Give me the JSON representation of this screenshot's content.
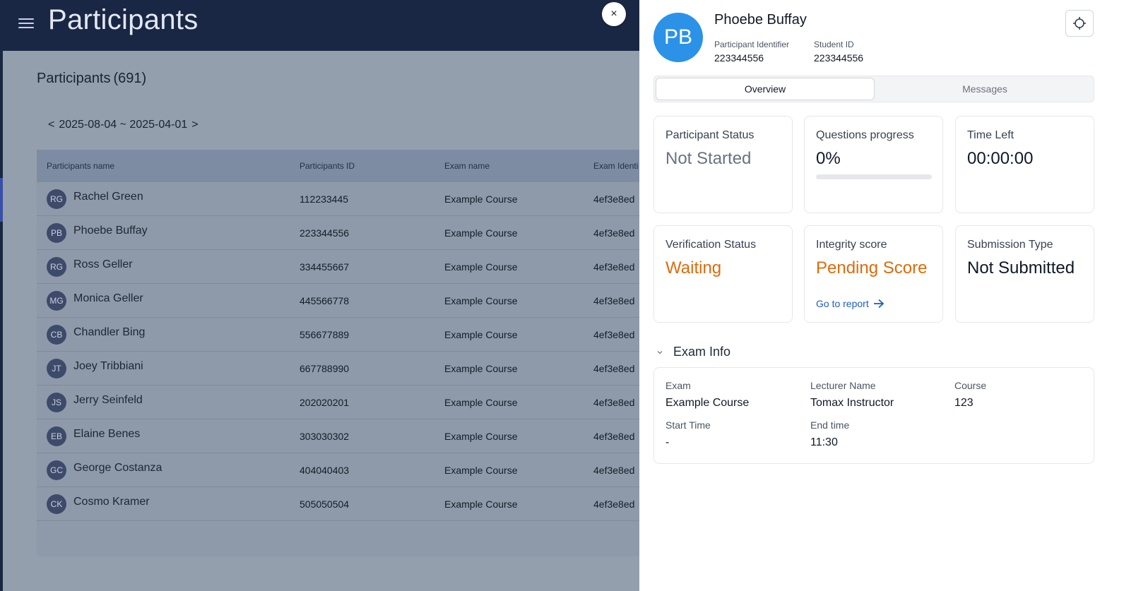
{
  "app": {
    "title": "Participants",
    "count_label": "Participants",
    "count": "(691)",
    "date_prev": "<",
    "date_range": "2025-08-04 ~ 2025-04-01",
    "date_next": ">"
  },
  "table": {
    "headers": [
      "Participants name",
      "Participants ID",
      "Exam name",
      "Exam Identi"
    ],
    "rows": [
      {
        "initials": "RG",
        "name": "Rachel Green",
        "id": "112233445",
        "exam": "Example Course",
        "ident": "4ef3e8ed"
      },
      {
        "initials": "PB",
        "name": "Phoebe Buffay",
        "id": "223344556",
        "exam": "Example Course",
        "ident": "4ef3e8ed"
      },
      {
        "initials": "RG",
        "name": "Ross Geller",
        "id": "334455667",
        "exam": "Example Course",
        "ident": "4ef3e8ed"
      },
      {
        "initials": "MG",
        "name": "Monica Geller",
        "id": "445566778",
        "exam": "Example Course",
        "ident": "4ef3e8ed"
      },
      {
        "initials": "CB",
        "name": "Chandler Bing",
        "id": "556677889",
        "exam": "Example Course",
        "ident": "4ef3e8ed"
      },
      {
        "initials": "JT",
        "name": "Joey Tribbiani",
        "id": "667788990",
        "exam": "Example Course",
        "ident": "4ef3e8ed"
      },
      {
        "initials": "JS",
        "name": "Jerry Seinfeld",
        "id": "202020201",
        "exam": "Example Course",
        "ident": "4ef3e8ed"
      },
      {
        "initials": "EB",
        "name": "Elaine Benes",
        "id": "303030302",
        "exam": "Example Course",
        "ident": "4ef3e8ed"
      },
      {
        "initials": "GC",
        "name": "George Costanza",
        "id": "404040403",
        "exam": "Example Course",
        "ident": "4ef3e8ed"
      },
      {
        "initials": "CK",
        "name": "Cosmo Kramer",
        "id": "505050504",
        "exam": "Example Course",
        "ident": "4ef3e8ed"
      }
    ]
  },
  "drawer": {
    "close_icon": "×",
    "avatar_initials": "PB",
    "name": "Phoebe Buffay",
    "participant_identifier_label": "Participant Identifier",
    "participant_identifier": "223344556",
    "student_id_label": "Student ID",
    "student_id": "223344556",
    "tabs": [
      "Overview",
      "Messages"
    ],
    "cards": {
      "participant_status": {
        "label": "Participant Status",
        "value": "Not Started"
      },
      "questions_progress": {
        "label": "Questions progress",
        "value": "0%",
        "fraction": 0
      },
      "time_left": {
        "label": "Time Left",
        "value": "00:00:00"
      },
      "verification_status": {
        "label": "Verification Status",
        "value": "Waiting"
      },
      "integrity_score": {
        "label": "Integrity score",
        "value": "Pending Score",
        "link": "Go to report"
      },
      "submission_type": {
        "label": "Submission Type",
        "value": "Not Submitted"
      }
    },
    "exam_info": {
      "title": "Exam Info",
      "exam_label": "Exam",
      "exam": "Example Course",
      "lecturer_label": "Lecturer Name",
      "lecturer": "Tomax Instructor",
      "course_label": "Course",
      "course": "123",
      "start_label": "Start Time",
      "start": "-",
      "end_label": "End time",
      "end": "11:30"
    }
  },
  "colors": {
    "navy": "#1a2744",
    "accent_blue": "#2b92e8",
    "warning_orange": "#dd6b0a",
    "link_blue": "#1d5fbf"
  }
}
